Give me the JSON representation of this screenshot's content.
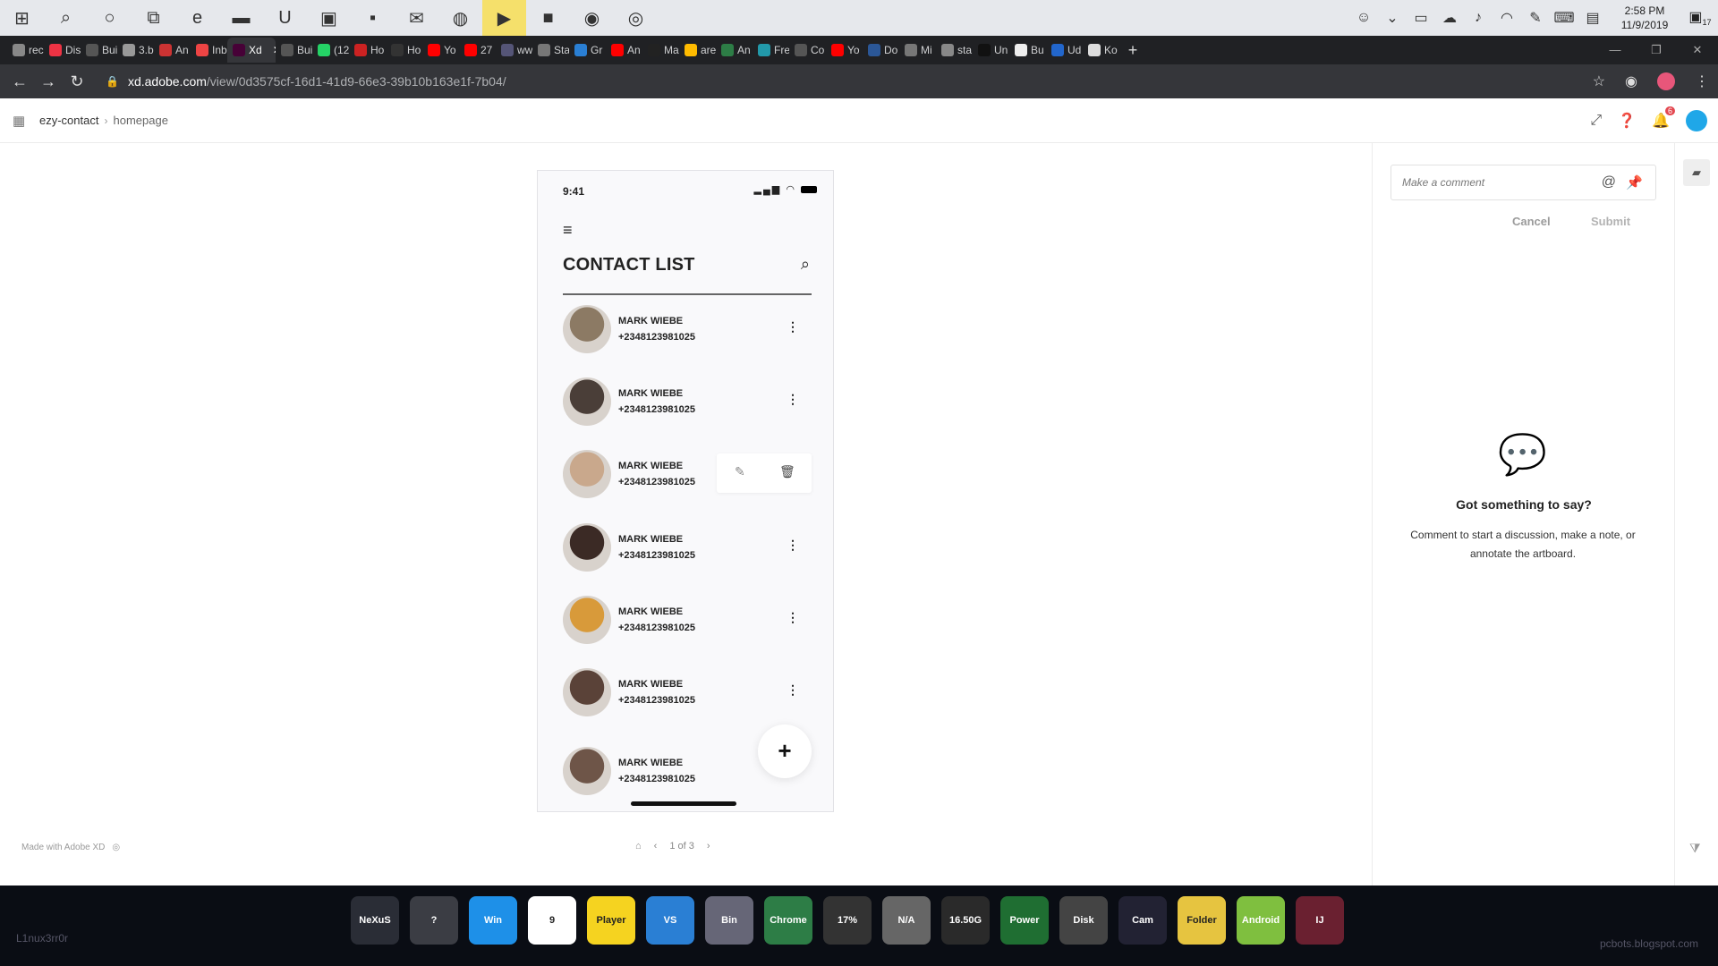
{
  "taskbar": {
    "icons": [
      "windows-start",
      "search",
      "cortana",
      "task-view",
      "edge",
      "file-explorer",
      "upwork",
      "store",
      "sticky-notes",
      "mail",
      "chrome-remote",
      "player-active",
      "green-app",
      "android-app",
      "chrome"
    ],
    "clock_time": "2:58 PM",
    "clock_date": "11/9/2019",
    "notif_count": "17"
  },
  "browser": {
    "tabs": [
      "rec",
      "Dis",
      "Bui",
      "3.b",
      "An",
      "Inb",
      "Xd",
      "Bui",
      "(12",
      "Ho",
      "Ho",
      "Yo",
      "27",
      "ww",
      "Sta",
      "Gr",
      "An",
      "Ma",
      "are",
      "An",
      "Fre",
      "Co",
      "Yo",
      "Do",
      "Mi",
      "sta",
      "Un",
      "Bu",
      "Ud",
      "Ko"
    ],
    "active_tab_index": 6,
    "new_tab_label": "+",
    "url_host": "xd.adobe.com",
    "url_path": "/view/0d3575cf-16d1-41d9-66e3-39b10b163e1f-7b04/"
  },
  "xd": {
    "project": "ezy-contact",
    "page": "homepage",
    "notif_badge": "6"
  },
  "phone": {
    "time": "9:41",
    "title": "CONTACT LIST",
    "contacts": [
      {
        "name": "MARK WIEBE",
        "phone": "+2348123981025",
        "avatar_color": "#8c7a64",
        "show_actions": false
      },
      {
        "name": "MARK WIEBE",
        "phone": "+2348123981025",
        "avatar_color": "#4a3e38",
        "show_actions": false
      },
      {
        "name": "MARK WIEBE",
        "phone": "+2348123981025",
        "avatar_color": "#c9a88c",
        "show_actions": true
      },
      {
        "name": "MARK WIEBE",
        "phone": "+2348123981025",
        "avatar_color": "#3b2a25",
        "show_actions": false
      },
      {
        "name": "MARK WIEBE",
        "phone": "+2348123981025",
        "avatar_color": "#d89a3a",
        "show_actions": false
      },
      {
        "name": "MARK WIEBE",
        "phone": "+2348123981025",
        "avatar_color": "#5a4238",
        "show_actions": false
      },
      {
        "name": "MARK WIEBE",
        "phone": "+2348123981025",
        "avatar_color": "#6e5548",
        "show_actions": false
      }
    ],
    "fab_label": "+"
  },
  "footer": {
    "made_with": "Made with Adobe XD",
    "pager": "1 of 3"
  },
  "comments": {
    "placeholder": "Make a comment",
    "cancel": "Cancel",
    "submit": "Submit",
    "empty_title": "Got something to say?",
    "empty_text": "Comment to start a discussion, make a note, or annotate the artboard."
  },
  "dock": {
    "left_text": "L1nux3rr0r",
    "right_text": "pcbots.blogspot.com",
    "items": [
      "NeXuS",
      "?",
      "Win",
      "9",
      "Player",
      "VS",
      "Bin",
      "Chrome",
      "17%",
      "N/A",
      "16.50G",
      "Power",
      "Disk",
      "Cam",
      "Folder",
      "Android",
      "IJ"
    ],
    "colors": [
      "#2a2d36",
      "#3b3d44",
      "#1e90e8",
      "#ffffff",
      "#f5d320",
      "#2a7fd4",
      "#667",
      "#2d7d46",
      "#333",
      "#666",
      "#2a2a2a",
      "#1f6e32",
      "#444",
      "#223",
      "#e6c440",
      "#7fbf3f",
      "#6a2030"
    ]
  },
  "colors": {
    "accent_blue": "#1fa7e8",
    "badge_red": "#e34850"
  }
}
